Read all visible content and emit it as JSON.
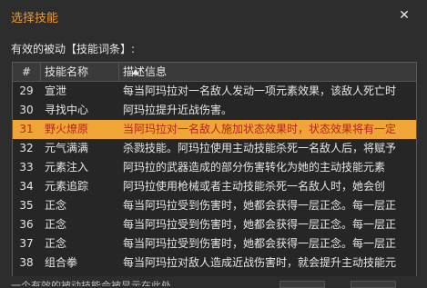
{
  "dialog": {
    "title": "选择技能",
    "close_glyph": "✕",
    "subtitle": "有效的被动【技能词条】:"
  },
  "table": {
    "columns": {
      "num": "#",
      "name": "技能名称",
      "desc": "描述信息"
    },
    "rows": [
      {
        "num": "29",
        "name": "宣泄",
        "desc": "每当阿玛拉对一名敌人发动一项元素效果，该敌人死亡时"
      },
      {
        "num": "30",
        "name": "寻找中心",
        "desc": "阿玛拉提升近战伤害。"
      },
      {
        "num": "31",
        "name": "野火燎原",
        "desc": "当阿玛拉对一名敌人施加状态效果时，状态效果将有一定"
      },
      {
        "num": "32",
        "name": "元气满满",
        "desc": "杀戮技能。阿玛拉使用主动技能杀死一名敌人后，将赋予"
      },
      {
        "num": "33",
        "name": "元素注入",
        "desc": "阿玛拉的武器造成的部分伤害转化为她的主动技能元素"
      },
      {
        "num": "34",
        "name": "元素追踪",
        "desc": "阿玛拉使用枪械或者主动技能杀死一名敌人时，她会创"
      },
      {
        "num": "35",
        "name": "正念",
        "desc": "每当阿玛拉受到伤害时，她都会获得一层正念。每一层正"
      },
      {
        "num": "36",
        "name": "正念",
        "desc": "每当阿玛拉受到伤害时，她都会获得一层正念。每一层正"
      },
      {
        "num": "37",
        "name": "正念",
        "desc": "每当阿玛拉受到伤害时，她都会获得一层正念。每一层正"
      },
      {
        "num": "38",
        "name": "组合拳",
        "desc": "每当阿玛拉对敌人造成近战伤害时，就会提升主动技能元"
      }
    ],
    "selected_row": "31"
  },
  "footer": {
    "hint": "一个有效的被动技能会被显示在此处"
  },
  "colors": {
    "accent": "#e89a3a",
    "selected_bg": "#f0a637",
    "selected_text": "#b3261e"
  }
}
